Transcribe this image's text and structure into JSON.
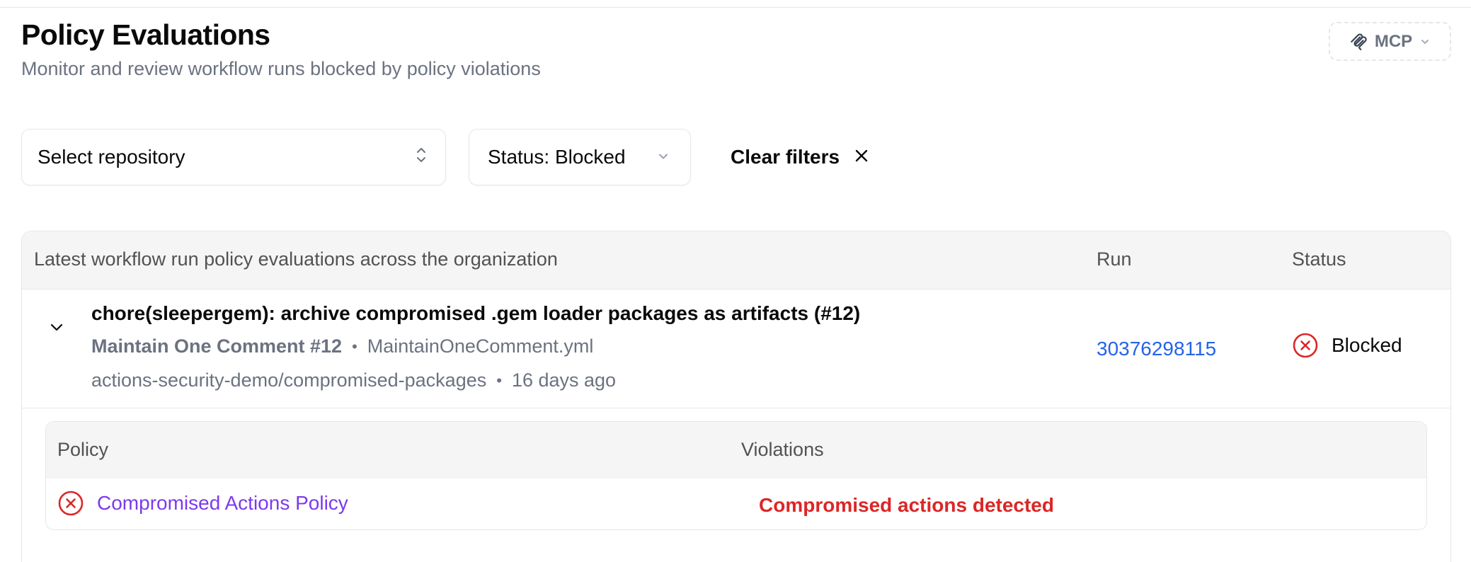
{
  "header": {
    "title": "Policy Evaluations",
    "subtitle": "Monitor and review workflow runs blocked by policy violations",
    "mcp_label": "MCP"
  },
  "filters": {
    "repository_placeholder": "Select repository",
    "status_label": "Status: Blocked",
    "clear_label": "Clear filters"
  },
  "table": {
    "columns": {
      "description": "Latest workflow run policy evaluations across the organization",
      "run": "Run",
      "status": "Status"
    },
    "rows": [
      {
        "title": "chore(sleepergem): archive compromised .gem loader packages as artifacts (#12)",
        "workflow_name": "Maintain One Comment #12",
        "workflow_file": "MaintainOneComment.yml",
        "repository": "actions-security-demo/compromised-packages",
        "age": "16 days ago",
        "run_id": "30376298115",
        "status": "Blocked",
        "details": {
          "columns": {
            "policy": "Policy",
            "violations": "Violations"
          },
          "items": [
            {
              "policy": "Compromised Actions Policy",
              "violation": "Compromised actions detected"
            }
          ]
        }
      }
    ]
  },
  "colors": {
    "link_blue": "#2563eb",
    "policy_purple": "#7c3aed",
    "error_red": "#dc2626"
  },
  "icons": [
    "mcp-icon",
    "chevron-down-icon",
    "chevron-up-down-icon",
    "close-icon",
    "x-circle-icon"
  ],
  "separator": "•"
}
